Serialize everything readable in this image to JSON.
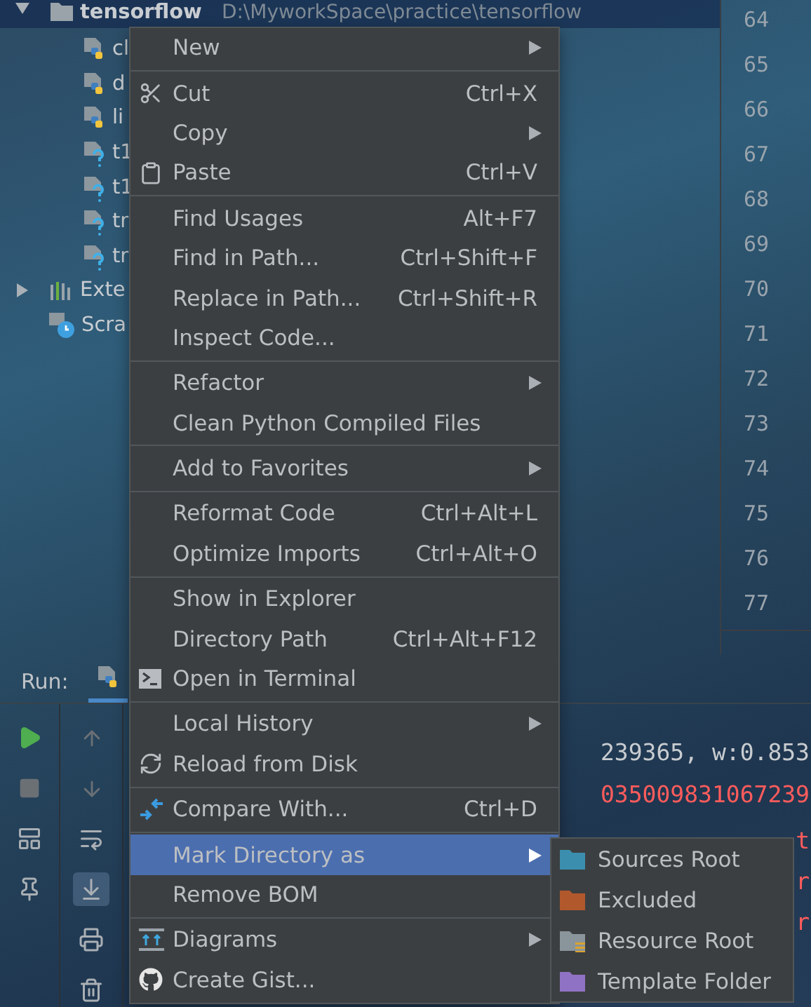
{
  "project_tree": {
    "root": {
      "name": "tensorflow",
      "path": "D:\\MyworkSpace\\practice\\tensorflow",
      "expanded": true,
      "selected": true,
      "children": [
        {
          "name": "cl",
          "kind": "python"
        },
        {
          "name": "d",
          "kind": "python"
        },
        {
          "name": "li",
          "kind": "python"
        },
        {
          "name": "t1",
          "kind": "unknown"
        },
        {
          "name": "t1",
          "kind": "unknown"
        },
        {
          "name": "tr",
          "kind": "unknown"
        },
        {
          "name": "tr",
          "kind": "unknown"
        }
      ]
    },
    "others": [
      {
        "name": "Exte",
        "kind": "libraries",
        "expanded": false
      },
      {
        "name": "Scra",
        "kind": "scratches"
      }
    ]
  },
  "line_numbers": [
    "64",
    "65",
    "66",
    "67",
    "68",
    "69",
    "70",
    "71",
    "72",
    "73",
    "74",
    "75",
    "76",
    "77"
  ],
  "run_panel": {
    "title": "Run:",
    "console_lines": [
      {
        "text": "239365, w:0.853",
        "kind": "normal"
      },
      {
        "text": "035009831067239",
        "kind": "error"
      },
      {
        "text": "t",
        "kind": "error"
      },
      {
        "text": "r",
        "kind": "error"
      },
      {
        "text": "r",
        "kind": "error"
      }
    ]
  },
  "context_menu": {
    "groups": [
      [
        {
          "label": "New",
          "submenu": true,
          "selected": false
        }
      ],
      [
        {
          "label": "Cut",
          "shortcut": "Ctrl+X",
          "selected": false
        },
        {
          "label": "Copy",
          "submenu": true,
          "selected": false
        },
        {
          "label": "Paste",
          "shortcut": "Ctrl+V",
          "selected": false
        }
      ],
      [
        {
          "label": "Find Usages",
          "shortcut": "Alt+F7",
          "selected": false
        },
        {
          "label": "Find in Path...",
          "shortcut": "Ctrl+Shift+F",
          "selected": false
        },
        {
          "label": "Replace in Path...",
          "shortcut": "Ctrl+Shift+R",
          "selected": false
        },
        {
          "label": "Inspect Code...",
          "selected": false
        }
      ],
      [
        {
          "label": "Refactor",
          "submenu": true,
          "selected": false
        },
        {
          "label": "Clean Python Compiled Files",
          "selected": false
        }
      ],
      [
        {
          "label": "Add to Favorites",
          "submenu": true,
          "selected": false
        }
      ],
      [
        {
          "label": "Reformat Code",
          "shortcut": "Ctrl+Alt+L",
          "selected": false
        },
        {
          "label": "Optimize Imports",
          "shortcut": "Ctrl+Alt+O",
          "selected": false
        }
      ],
      [
        {
          "label": "Show in Explorer",
          "selected": false
        },
        {
          "label": "Directory Path",
          "shortcut": "Ctrl+Alt+F12",
          "selected": false
        },
        {
          "label": "Open in Terminal",
          "selected": false
        }
      ],
      [
        {
          "label": "Local History",
          "submenu": true,
          "selected": false
        },
        {
          "label": "Reload from Disk",
          "selected": false
        }
      ],
      [
        {
          "label": "Compare With...",
          "shortcut": "Ctrl+D",
          "selected": false
        }
      ],
      [
        {
          "label": "Mark Directory as",
          "submenu": true,
          "selected": true
        },
        {
          "label": "Remove BOM",
          "selected": false
        }
      ],
      [
        {
          "label": "Diagrams",
          "submenu": true,
          "selected": false
        },
        {
          "label": "Create Gist...",
          "selected": false
        }
      ]
    ]
  },
  "submenu": {
    "items": [
      {
        "label": "Sources Root",
        "kind": "folder",
        "color": "#3b8eae"
      },
      {
        "label": "Excluded",
        "kind": "folder",
        "color": "#b2582d"
      },
      {
        "label": "Resource Root",
        "kind": "resource-folder",
        "color": "#8a949b"
      },
      {
        "label": "Template Folder",
        "kind": "folder",
        "color": "#9072c4"
      }
    ]
  }
}
